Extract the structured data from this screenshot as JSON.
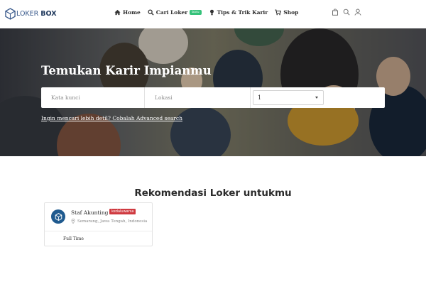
{
  "brand": {
    "logo_text": "LOKER",
    "logo_bold": "BOX",
    "color": "#3a5a8c"
  },
  "nav": {
    "items": [
      {
        "label": "Home",
        "icon": "home-icon"
      },
      {
        "label": "Cari Loker",
        "icon": "search-icon",
        "badge": "baru"
      },
      {
        "label": "Tips & Trik Karir",
        "icon": "lightbulb-icon"
      },
      {
        "label": "Shop",
        "icon": "cart-icon"
      }
    ],
    "right_icons": [
      "shopping-bag-icon",
      "search-icon",
      "user-icon"
    ],
    "badge_color": "#35c27a"
  },
  "hero": {
    "title": "Temukan Karir Impianmu",
    "keyword_placeholder": "Kata kunci",
    "location_placeholder": "Lokasi",
    "select_value": "1",
    "advanced_link": "Ingin mencari lebih detil? Cobalah Advanced search"
  },
  "recommendations": {
    "title": "Rekomendasi Loker untukmu",
    "jobs": [
      {
        "title": "Staf Akunting",
        "badge": "kedaluwarsa",
        "badge_color": "#cf3a40",
        "location": "Semarang, Jawa Tengah, Indonesia",
        "type": "Full Time",
        "logo_color": "#1f5a8f"
      }
    ]
  }
}
